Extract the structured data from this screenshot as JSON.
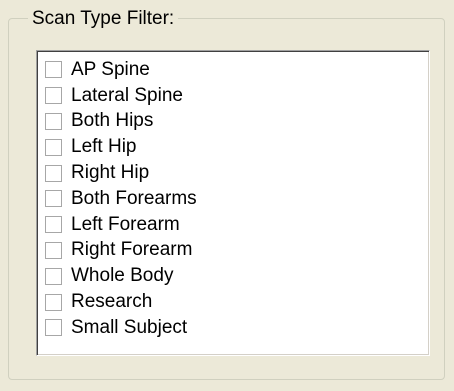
{
  "filter": {
    "title": "Scan Type Filter:",
    "items": [
      {
        "label": "AP Spine",
        "checked": false
      },
      {
        "label": "Lateral Spine",
        "checked": false
      },
      {
        "label": "Both Hips",
        "checked": false
      },
      {
        "label": "Left Hip",
        "checked": false
      },
      {
        "label": "Right Hip",
        "checked": false
      },
      {
        "label": "Both Forearms",
        "checked": false
      },
      {
        "label": "Left Forearm",
        "checked": false
      },
      {
        "label": "Right Forearm",
        "checked": false
      },
      {
        "label": "Whole Body",
        "checked": false
      },
      {
        "label": "Research",
        "checked": false
      },
      {
        "label": "Small Subject",
        "checked": false
      }
    ]
  },
  "colors": {
    "background": "#ece9d8",
    "list_background": "#ffffff",
    "checkbox_border": "#a7a7a7"
  }
}
